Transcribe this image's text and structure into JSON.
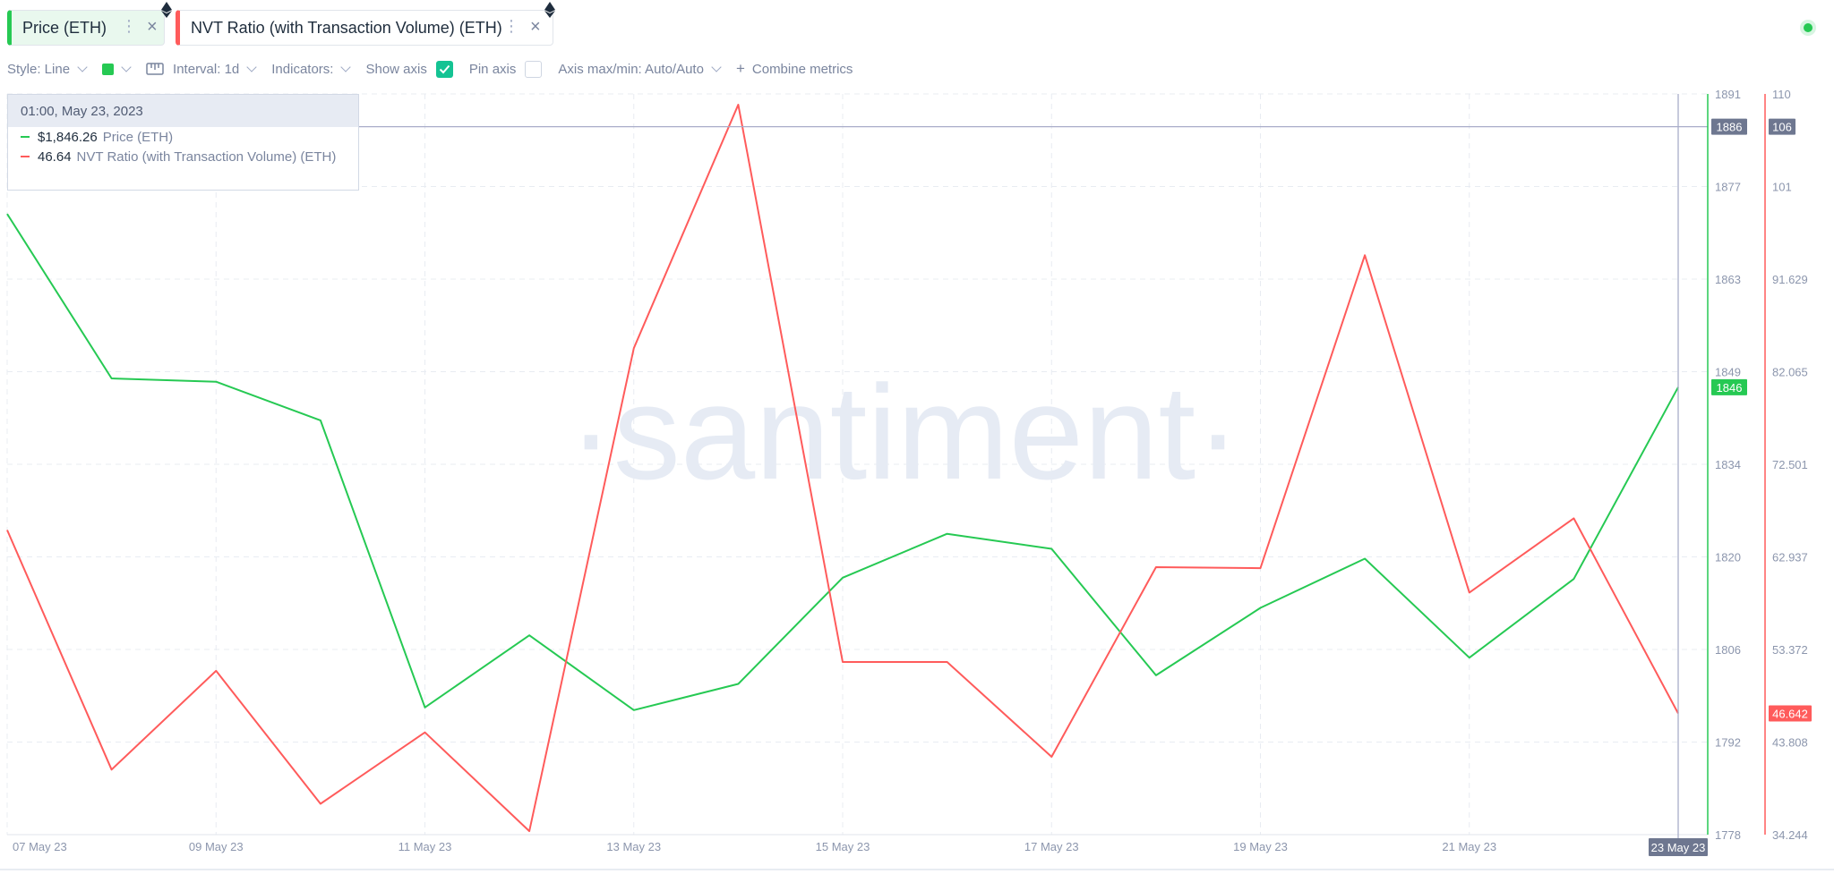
{
  "metrics": [
    {
      "label": "Price (ETH)",
      "menu_icon": "kebab-menu-icon",
      "close_icon": "close-icon",
      "color": "#26c953",
      "active": true
    },
    {
      "label": "NVT Ratio (with Transaction Volume) (ETH)",
      "menu_icon": "kebab-menu-icon",
      "close_icon": "close-icon",
      "color": "#ff5b5b",
      "active": false
    }
  ],
  "toolbar": {
    "style": "Style: Line",
    "interval": "Interval: 1d",
    "indicators": "Indicators:",
    "show_axis": "Show axis",
    "show_axis_checked": true,
    "pin_axis": "Pin axis",
    "pin_axis_checked": false,
    "axis_maxmin": "Axis max/min: Auto/Auto",
    "combine": "Combine metrics",
    "combine_prefix": "+",
    "line_color": "#26c953"
  },
  "tooltip": {
    "date": "01:00, May 23, 2023",
    "rows": [
      {
        "value": "$1,846.26",
        "name": "Price (ETH)",
        "color": "#26c953"
      },
      {
        "value": "46.64",
        "name": "NVT Ratio (with Transaction Volume) (ETH)",
        "color": "#ff5b5b"
      }
    ]
  },
  "watermark": "·santiment·",
  "chart_data": {
    "type": "line",
    "x": [
      "07 May 23",
      "08 May 23",
      "09 May 23",
      "10 May 23",
      "11 May 23",
      "12 May 23",
      "13 May 23",
      "14 May 23",
      "15 May 23",
      "16 May 23",
      "17 May 23",
      "18 May 23",
      "19 May 23",
      "20 May 23",
      "21 May 23",
      "22 May 23",
      "23 May 23"
    ],
    "x_tick_labels": [
      "07 May 23",
      "09 May 23",
      "11 May 23",
      "13 May 23",
      "15 May 23",
      "17 May 23",
      "19 May 23",
      "21 May 23",
      "23 May 23"
    ],
    "x_tick_indices": [
      0,
      2,
      4,
      6,
      8,
      10,
      12,
      14,
      16
    ],
    "series": [
      {
        "name": "Price (ETH)",
        "color": "#26c953",
        "axis": "left",
        "values": [
          1872.7,
          1847.6,
          1847.1,
          1841.2,
          1797.4,
          1808.4,
          1797.0,
          1801.0,
          1817.2,
          1823.9,
          1821.6,
          1802.3,
          1812.6,
          1820.1,
          1805.0,
          1817.0,
          1846.26
        ]
      },
      {
        "name": "NVT Ratio (with Transaction Volume) (ETH)",
        "color": "#ff5b5b",
        "axis": "right",
        "values": [
          65.4,
          40.9,
          51.0,
          37.4,
          44.7,
          34.6,
          84.0,
          108.9,
          51.9,
          51.9,
          42.2,
          61.6,
          61.5,
          93.5,
          59.0,
          66.6,
          46.64
        ]
      }
    ],
    "y_left": {
      "min": 1778,
      "max": 1891,
      "ticks": [
        1778,
        1792,
        1806,
        1820,
        1834,
        1849,
        1863,
        1877,
        1891
      ]
    },
    "y_right": {
      "min": 34.244,
      "max": 110,
      "ticks": [
        "34.244",
        "43.808",
        "53.372",
        "62.937",
        "72.501",
        "82.065",
        "91.629",
        "101",
        "110"
      ]
    },
    "crosshair": {
      "left_value": "1886",
      "right_value": "106",
      "x_label": "23 May 23"
    },
    "last_values": {
      "left": "1846",
      "right": "46.642"
    },
    "grid": true
  }
}
